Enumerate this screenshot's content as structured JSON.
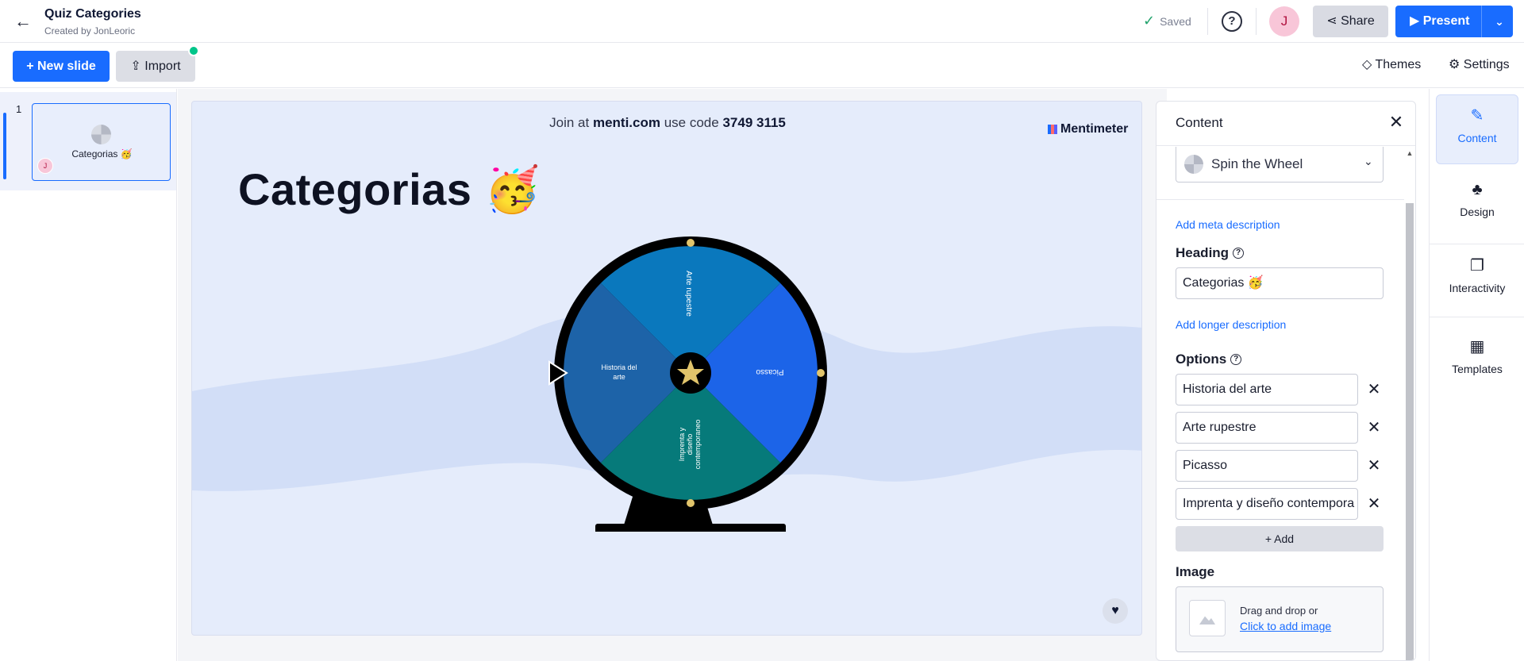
{
  "header": {
    "title": "Quiz Categories",
    "subtitle": "Created by JonLeoric",
    "saved_label": "Saved",
    "avatar_initial": "J",
    "share_label": "Share",
    "present_label": "Present"
  },
  "toolbar": {
    "new_slide_label": "+ New slide",
    "import_label": "Import",
    "themes_label": "Themes",
    "settings_label": "Settings"
  },
  "slides": [
    {
      "number": "1",
      "title": "Categorias 🥳",
      "avatar_initial": "J"
    }
  ],
  "slide": {
    "join_prefix": "Join at",
    "join_url": "menti.com",
    "join_middle": "use code",
    "join_code": "3749 3115",
    "brand": "Mentimeter",
    "heading": "Categorias 🥳",
    "wheel_labels": [
      "Arte rupestre",
      "Picasso",
      "Imprenta y diseño contemporaneo",
      "Historia del arte"
    ]
  },
  "content_panel": {
    "title": "Content",
    "type_label": "Spin the Wheel",
    "add_meta_label": "Add meta description",
    "heading_label": "Heading",
    "heading_value": "Categorias 🥳",
    "add_longer_label": "Add longer description",
    "options_label": "Options",
    "options": [
      "Historia del arte",
      "Arte rupestre",
      "Picasso",
      "Imprenta y diseño contempora"
    ],
    "add_label": "+ Add",
    "image_label": "Image",
    "image_hint": "Drag and drop or",
    "image_link": "Click to add image"
  },
  "rail": {
    "items": [
      "Content",
      "Design",
      "Interactivity",
      "Templates"
    ]
  },
  "colors": {
    "accent": "#196cff",
    "wheel_segments": [
      "#0a78bd",
      "#1c64e8",
      "#067a7a",
      "#1d63a8"
    ]
  }
}
